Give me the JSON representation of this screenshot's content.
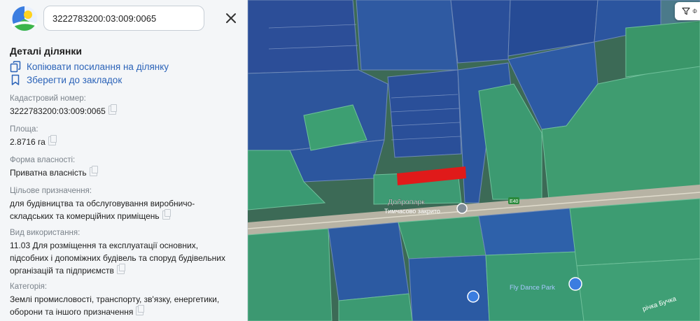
{
  "search": {
    "value": "3222783200:03:009:0065"
  },
  "panel": {
    "title": "Деталі ділянки",
    "copy_link_label": "Копіювати посилання на ділянку",
    "bookmark_label": "Зберегти до закладок"
  },
  "details": {
    "cadastral_label": "Кадастровий номер:",
    "cadastral_value": "3222783200:03:009:0065",
    "area_label": "Площа:",
    "area_value": "2.8716 га",
    "ownership_label": "Форма власності:",
    "ownership_value": "Приватна власність",
    "purpose_label": "Цільове призначення:",
    "purpose_value": "для будівництва та обслуговування виробничо-складських та комерційних приміщень",
    "usage_label": "Вид використання:",
    "usage_value": "11.03 Для розміщення та експлуатації основних, підсобних і допоміжних будівель та споруд будівельних організацій та підприємств",
    "category_label": "Категорія:",
    "category_value": "Землі промисловості, транспорту, зв'язку, енергетики, оборони та іншого призначення"
  },
  "map": {
    "poi_name": "Добропарк",
    "poi_status": "Тимчасово закрито",
    "road_label": "E40",
    "park_label": "Fly Dance Park",
    "river_label": "річка Бучка",
    "filter_label": "Ф",
    "colors": {
      "highlight": "#e01a1a",
      "private_blue": "#2a4f9a",
      "green_zone": "#3f9c70",
      "accent": "#2b63b8"
    }
  }
}
